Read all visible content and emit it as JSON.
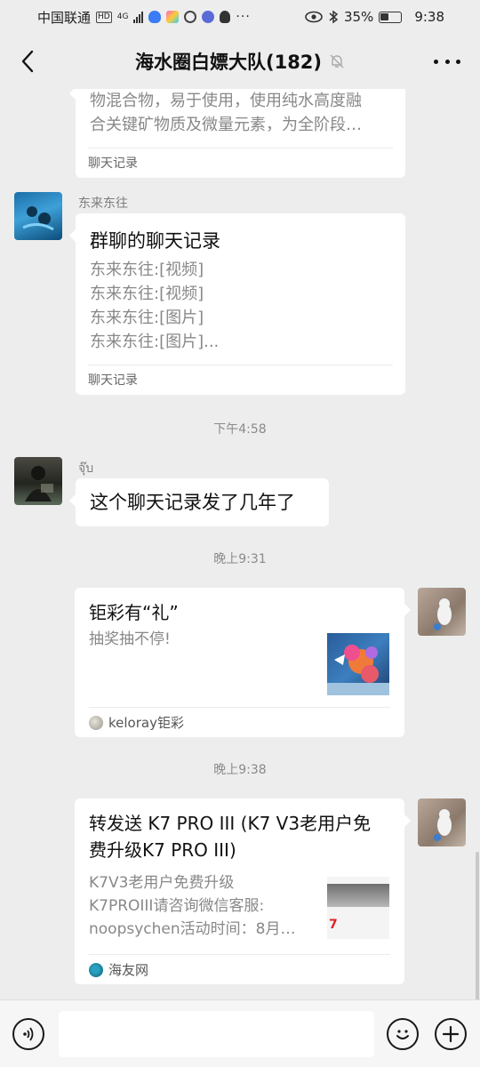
{
  "status_bar": {
    "carrier": "中国联通",
    "hd_badge": "HD",
    "net_badge": "4G",
    "battery_percent": "35%",
    "battery_level": 0.35,
    "time": "9:38"
  },
  "nav": {
    "title": "海水圈白嫖大队(182)",
    "muted_icon": "bell-off-icon"
  },
  "messages": {
    "record0": {
      "lines": [
        "物混合物，易于使用，使用纯水高度融",
        "合关键矿物质及微量元素，为全阶段…"
      ],
      "footer": "聊天记录"
    },
    "record1": {
      "sender": "东来东往",
      "title": "群聊的聊天记录",
      "lines": [
        "东来东往:[视频]",
        "东来东往:[视频]",
        "东来东往:[图片]",
        "东来东往:[图片]..."
      ],
      "footer": "聊天记录"
    },
    "time1": "下午4:58",
    "text1": {
      "sender": "จุ๊บ",
      "text": "这个聊天记录发了几年了"
    },
    "time2": "晚上9:31",
    "link1": {
      "title": "钜彩有“礼”",
      "desc": "抽奖抽不停!",
      "source": "keloray钜彩"
    },
    "time3": "晚上9:38",
    "link2": {
      "title": "转发送 K7 PRO III (K7 V3老用户免费升级K7 PRO III)",
      "desc_lines": [
        "K7V3老用户免费升级",
        "K7PROIII请咨询微信客服:",
        "noopsychen活动时间：8月…"
      ],
      "source": "海友网",
      "thumb_text": "7"
    }
  },
  "input_bar": {
    "voice_icon": "voice-icon",
    "emoji_icon": "emoji-icon",
    "plus_icon": "plus-icon",
    "input_value": ""
  },
  "colors": {
    "background": "#ededed",
    "bubble": "#ffffff",
    "meta_text": "#8a8a8a"
  }
}
